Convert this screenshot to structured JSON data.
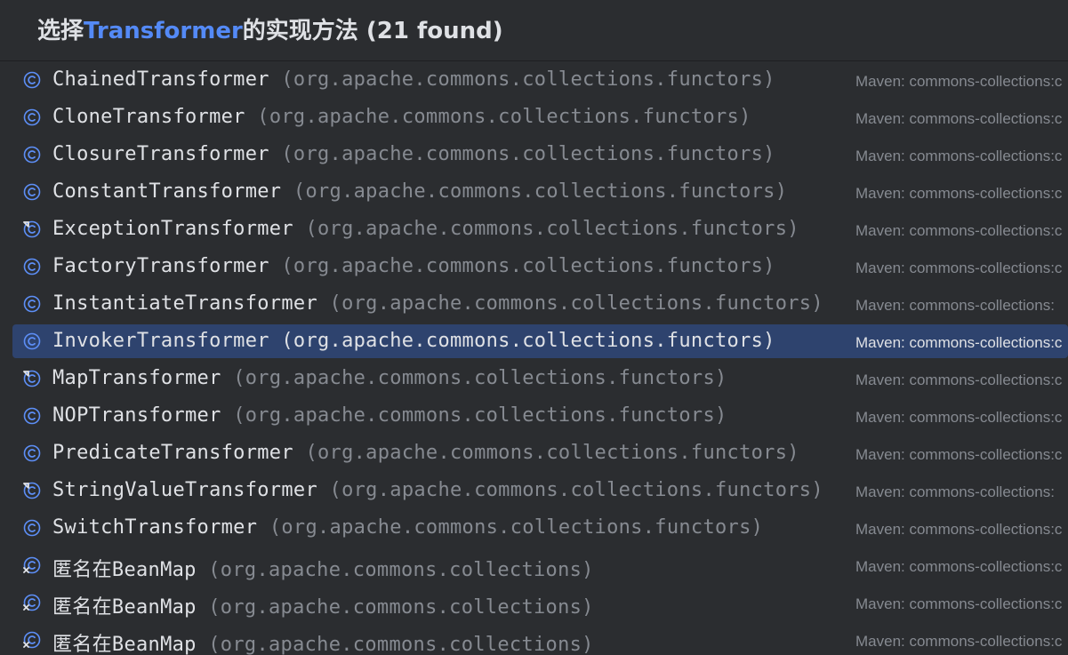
{
  "popup": {
    "title_prefix": "选择",
    "title_highlight": "Transformer",
    "title_suffix": "的实现方法 (21 found)"
  },
  "colors": {
    "background": "#2b2d30",
    "selected_row": "#2e436e",
    "highlight": "#548af7",
    "class_icon": "#5d8ff7",
    "primary_text": "#dfe1e5",
    "secondary_text": "#868a91"
  },
  "items": [
    {
      "name": "ChainedTransformer",
      "package": "(org.apache.commons.collections.functors)",
      "library": "Maven: commons-collections:c",
      "icon": "class-icon"
    },
    {
      "name": "CloneTransformer",
      "package": "(org.apache.commons.collections.functors)",
      "library": "Maven: commons-collections:c",
      "icon": "class-icon"
    },
    {
      "name": "ClosureTransformer",
      "package": "(org.apache.commons.collections.functors)",
      "library": "Maven: commons-collections:c",
      "icon": "class-icon"
    },
    {
      "name": "ConstantTransformer",
      "package": "(org.apache.commons.collections.functors)",
      "library": "Maven: commons-collections:c",
      "icon": "class-icon"
    },
    {
      "name": "ExceptionTransformer",
      "package": "(org.apache.commons.collections.functors)",
      "library": "Maven: commons-collections:c",
      "icon": "class-link-icon"
    },
    {
      "name": "FactoryTransformer",
      "package": "(org.apache.commons.collections.functors)",
      "library": "Maven: commons-collections:c",
      "icon": "class-icon"
    },
    {
      "name": "InstantiateTransformer",
      "package": "(org.apache.commons.collections.functors)",
      "library": "Maven: commons-collections:",
      "icon": "class-icon"
    },
    {
      "name": "InvokerTransformer",
      "package": "(org.apache.commons.collections.functors)",
      "library": "Maven: commons-collections:c",
      "icon": "class-icon",
      "selected": true
    },
    {
      "name": "MapTransformer",
      "package": "(org.apache.commons.collections.functors)",
      "library": "Maven: commons-collections:c",
      "icon": "class-link-icon"
    },
    {
      "name": "NOPTransformer",
      "package": "(org.apache.commons.collections.functors)",
      "library": "Maven: commons-collections:c",
      "icon": "class-icon"
    },
    {
      "name": "PredicateTransformer",
      "package": "(org.apache.commons.collections.functors)",
      "library": "Maven: commons-collections:c",
      "icon": "class-icon"
    },
    {
      "name": "StringValueTransformer",
      "package": "(org.apache.commons.collections.functors)",
      "library": "Maven: commons-collections:",
      "icon": "class-link-icon"
    },
    {
      "name": "SwitchTransformer",
      "package": "(org.apache.commons.collections.functors)",
      "library": "Maven: commons-collections:c",
      "icon": "class-icon"
    },
    {
      "name": "匿名在BeanMap",
      "package": "(org.apache.commons.collections)",
      "library": "Maven: commons-collections:c",
      "icon": "anonymous-class-icon"
    },
    {
      "name": "匿名在BeanMap",
      "package": "(org.apache.commons.collections)",
      "library": "Maven: commons-collections:c",
      "icon": "anonymous-class-icon"
    },
    {
      "name": "匿名在BeanMap",
      "package": "(org.apache.commons.collections)",
      "library": "Maven: commons-collections:c",
      "icon": "anonymous-class-icon"
    }
  ]
}
